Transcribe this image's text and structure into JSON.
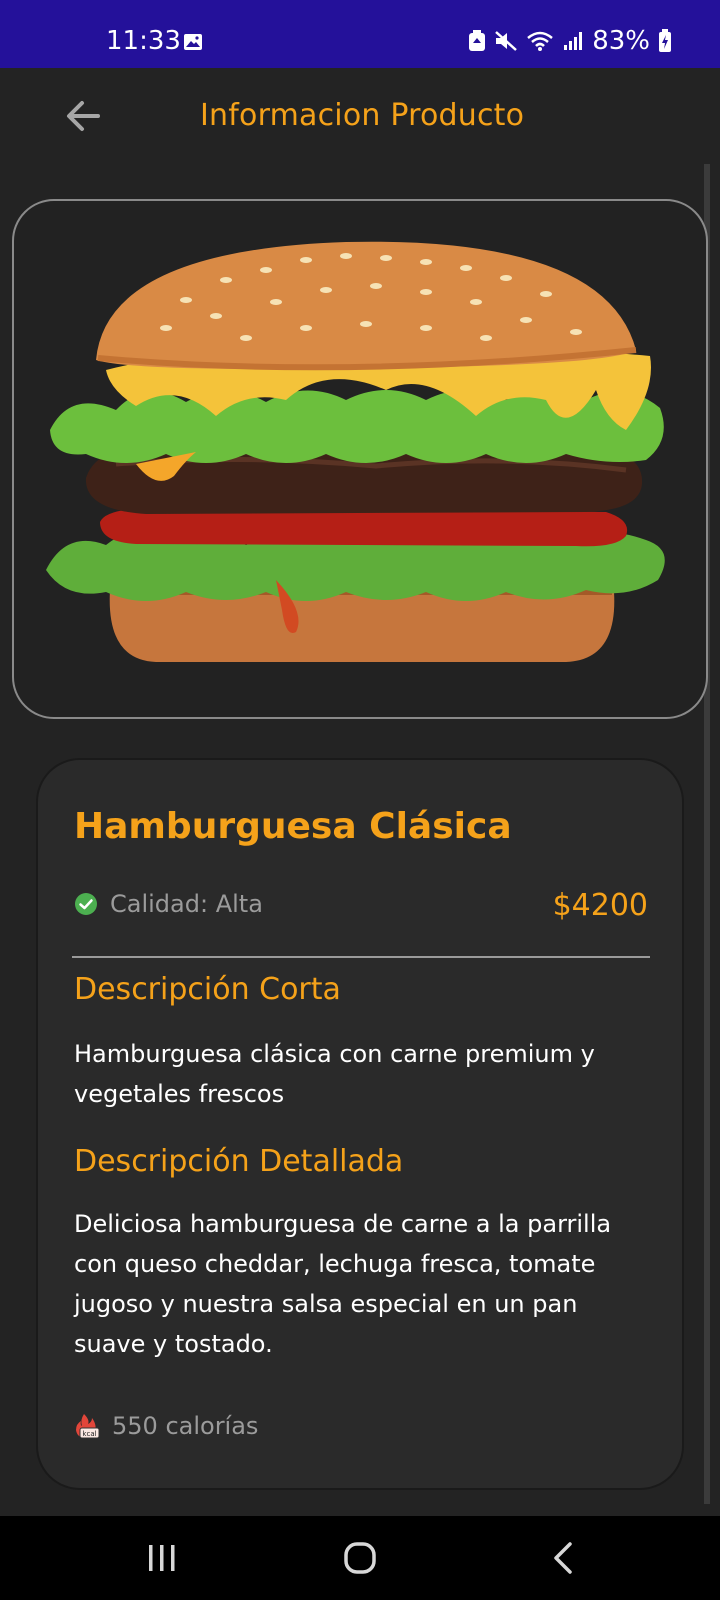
{
  "status_bar": {
    "time": "11:33",
    "battery": "83%",
    "icons": [
      "image-icon",
      "battery-saver-icon",
      "mute-icon",
      "wifi-icon",
      "signal-icon",
      "battery-icon"
    ]
  },
  "app_bar": {
    "title": "Informacion Producto",
    "back_icon": "arrow-left-icon"
  },
  "product": {
    "name": "Hamburguesa Clásica",
    "quality_label": "Calidad:",
    "quality_value": "Alta",
    "quality_line": "Calidad: Alta",
    "price": "$4200",
    "short_desc_title": "Descripción Corta",
    "short_desc": "Hamburguesa clásica con carne premium y vegetales frescos",
    "detail_desc_title": "Descripción Detallada",
    "detail_desc": "Deliciosa hamburguesa de carne a la parrilla con queso cheddar, lechuga fresca, tomate jugoso y nuestra salsa especial en un pan suave y tostado.",
    "calories": "550 calorías",
    "calories_icon_label": "kcal"
  },
  "colors": {
    "accent": "#f5a21a",
    "background": "#232323",
    "card": "#2a2a2a",
    "status_bar": "#24119a",
    "check_green": "#4caf50"
  },
  "nav_bar": {
    "items": [
      "recent-apps-icon",
      "home-icon",
      "back-icon"
    ]
  }
}
